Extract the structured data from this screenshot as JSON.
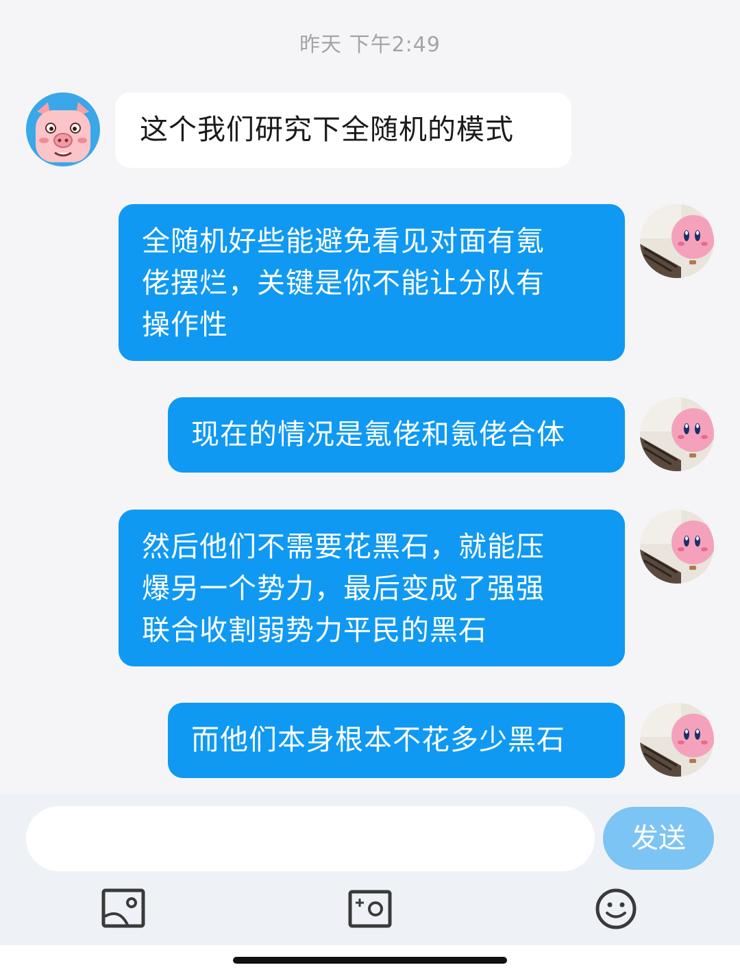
{
  "chat": {
    "timestamp": "昨天 下午2:49",
    "messages": [
      {
        "sender": "other",
        "avatar": "pig-avatar",
        "lines": [
          "这个我们研究下全随机的模式"
        ]
      },
      {
        "sender": "self",
        "avatar": "kirby-avatar",
        "lines": [
          "全随机好些能避免看见对面有氪",
          "佬摆烂，关键是你不能让分队有",
          "操作性"
        ]
      },
      {
        "sender": "self",
        "avatar": "kirby-avatar",
        "lines": [
          "现在的情况是氪佬和氪佬合体"
        ]
      },
      {
        "sender": "self",
        "avatar": "kirby-avatar",
        "lines": [
          "然后他们不需要花黑石，就能压",
          "爆另一个势力，最后变成了强强",
          "联合收割弱势力平民的黑石"
        ]
      },
      {
        "sender": "self",
        "avatar": "kirby-avatar",
        "lines": [
          "而他们本身根本不花多少黑石"
        ]
      }
    ]
  },
  "composer": {
    "input_value": "",
    "send_label": "发送",
    "tools": [
      {
        "icon": "image-icon"
      },
      {
        "icon": "camera-icon"
      },
      {
        "icon": "emoji-icon"
      }
    ]
  },
  "colors": {
    "self_bubble": "#0f99f2",
    "other_bubble": "#ffffff",
    "send_button": "#7cc4f3",
    "background": "#f5f5f7"
  }
}
